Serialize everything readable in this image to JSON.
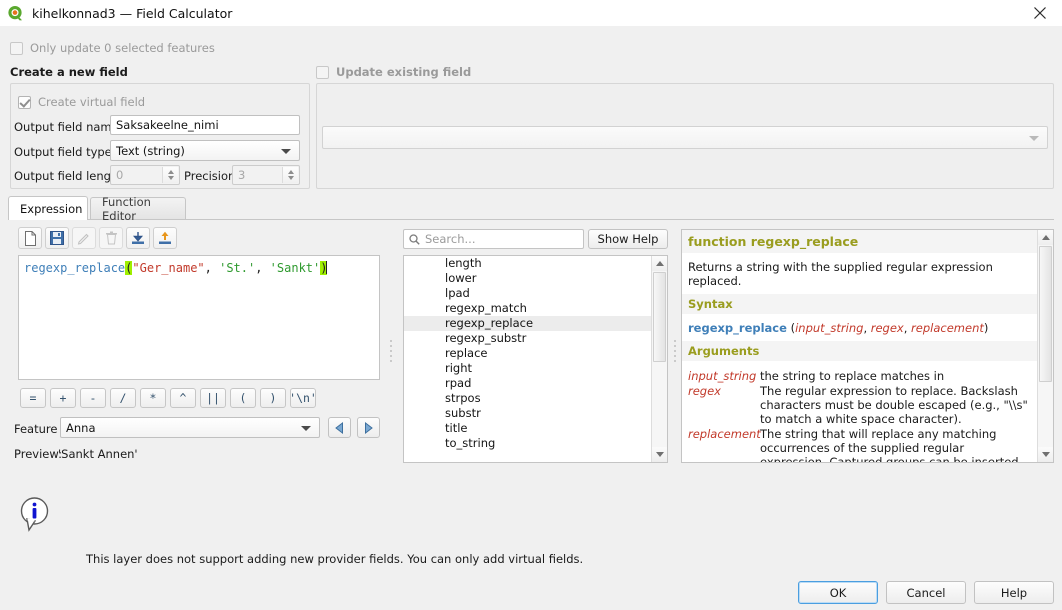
{
  "window": {
    "title": "kihelkonnad3 — Field Calculator",
    "logo_icon": "qgis-logo-icon",
    "close_icon": "close-icon"
  },
  "only_update": {
    "label": "Only update 0 selected features",
    "checked": false,
    "enabled": false
  },
  "create_new_field": {
    "title": "Create a new field",
    "virtual": {
      "label": "Create virtual field",
      "checked": true
    },
    "output_field_name": {
      "label": "Output field name",
      "value": "Saksakeelne_nimi"
    },
    "output_field_type": {
      "label": "Output field type",
      "value": "Text (string)"
    },
    "output_field_length": {
      "label": "Output field length",
      "value": "0"
    },
    "precision": {
      "label": "Precision",
      "value": "3"
    }
  },
  "update_existing_field": {
    "label": "Update existing field",
    "checked": false,
    "combo_value": ""
  },
  "tabs": [
    {
      "label": "Expression",
      "active": true
    },
    {
      "label": "Function Editor",
      "active": false
    }
  ],
  "expression_toolbar": [
    {
      "name": "new-expression-icon",
      "enabled": true
    },
    {
      "name": "save-expression-icon",
      "enabled": true
    },
    {
      "name": "edit-expression-icon",
      "enabled": false
    },
    {
      "name": "delete-expression-icon",
      "enabled": false
    },
    {
      "name": "import-expression-icon",
      "enabled": true
    },
    {
      "name": "export-expression-icon",
      "enabled": true
    }
  ],
  "expression": {
    "full_text": "regexp_replace(\"Ger_name\", 'St.', 'Sankt')",
    "tokens": {
      "function": "regexp_replace",
      "open_paren": "(",
      "field": "\"Ger_name\"",
      "comma1": ", ",
      "string1": "'St.'",
      "comma2": ", ",
      "string2": "'Sankt'",
      "close_paren": ")"
    },
    "colors": {
      "function": "#3f7fb8",
      "field": "#c23a2b",
      "string": "#2f9a2f",
      "brace_match_bg": "#9ff000"
    }
  },
  "operators": [
    "=",
    "+",
    "-",
    "/",
    "*",
    "^",
    "||",
    "(",
    ")",
    "'\\n'"
  ],
  "feature": {
    "label": "Feature",
    "value": "Anna",
    "prev_icon": "previous-feature-icon",
    "next_icon": "next-feature-icon"
  },
  "preview": {
    "label": "Preview:",
    "value": "'Sankt Annen'"
  },
  "function_search": {
    "placeholder": "Search...",
    "value": "",
    "icon": "search-icon"
  },
  "show_help_button": "Show Help",
  "function_list": {
    "items": [
      "length",
      "lower",
      "lpad",
      "regexp_match",
      "regexp_replace",
      "regexp_substr",
      "replace",
      "right",
      "rpad",
      "strpos",
      "substr",
      "title",
      "to_string"
    ],
    "selected": "regexp_replace"
  },
  "help": {
    "title": "function regexp_replace",
    "description": "Returns a string with the supplied regular expression replaced.",
    "syntax_heading": "Syntax",
    "syntax": {
      "function": "regexp_replace",
      "args": [
        "input_string",
        "regex",
        "replacement"
      ]
    },
    "arguments_heading": "Arguments",
    "arguments": [
      {
        "name": "input_string",
        "desc": "the string to replace matches in"
      },
      {
        "name": "regex",
        "desc": "The regular expression to replace. Backslash characters must be double escaped (e.g., \"\\\\s\" to match a white space character)."
      },
      {
        "name": "replacement",
        "desc": "The string that will replace any matching occurrences of the supplied regular expression. Captured groups can be inserted into the"
      }
    ]
  },
  "bottom": {
    "info_icon": "info-icon",
    "message": "This layer does not support adding new provider fields. You can only add virtual fields."
  },
  "dialog_buttons": [
    {
      "label": "OK",
      "focused": true
    },
    {
      "label": "Cancel",
      "focused": false
    },
    {
      "label": "Help",
      "focused": false
    }
  ]
}
